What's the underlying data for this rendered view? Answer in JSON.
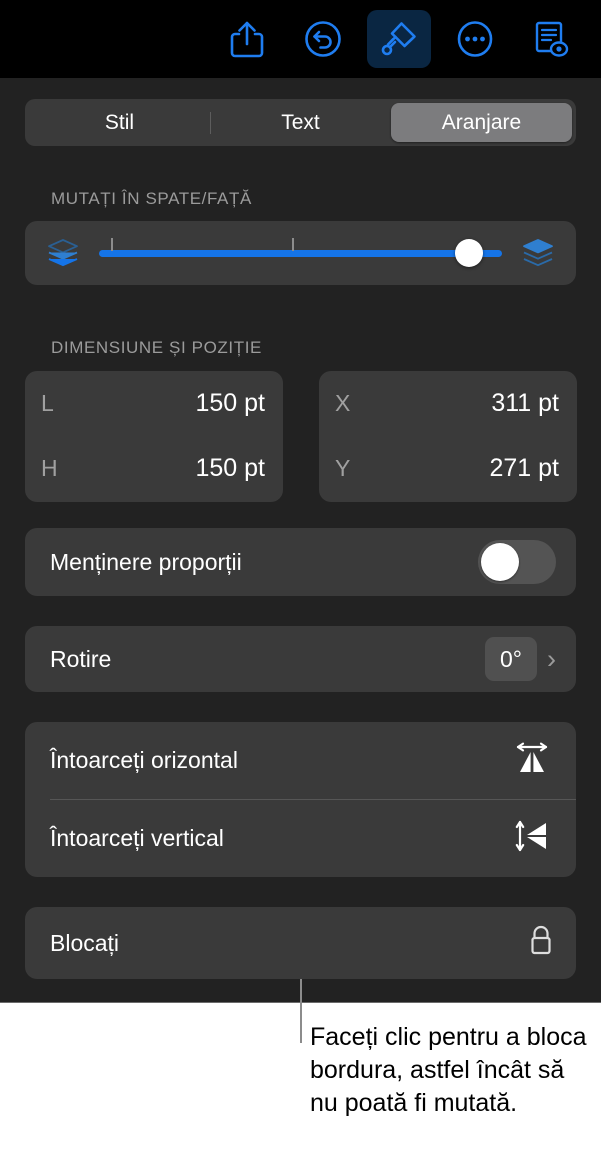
{
  "toolbar": {
    "buttons": [
      {
        "name": "share-icon",
        "label": "Partajați"
      },
      {
        "name": "undo-icon",
        "label": "Anulați"
      },
      {
        "name": "format-brush-icon",
        "label": "Format",
        "active": true
      },
      {
        "name": "more-options-icon",
        "label": "Mai multe"
      },
      {
        "name": "document-view-icon",
        "label": "Vizualizare document"
      }
    ]
  },
  "tabs": {
    "items": [
      {
        "label": "Stil",
        "selected": false
      },
      {
        "label": "Text",
        "selected": false
      },
      {
        "label": "Aranjare",
        "selected": true
      }
    ]
  },
  "arrange": {
    "back_front": {
      "title": "MUTAȚI ÎN SPATE/FAȚĂ",
      "slider": {
        "value_percent": 95,
        "tick_percents": [
          3,
          48
        ],
        "back_icon": "send-to-back-icon",
        "front_icon": "bring-to-front-icon",
        "accent_color": "#1574e8"
      }
    },
    "size_position": {
      "title": "DIMENSIUNE ȘI POZIȚIE",
      "size_fields": [
        {
          "label": "L",
          "value": "150 pt"
        },
        {
          "label": "H",
          "value": "150 pt"
        }
      ],
      "position_fields": [
        {
          "label": "X",
          "value": "311 pt"
        },
        {
          "label": "Y",
          "value": "271 pt"
        }
      ]
    },
    "constrain": {
      "label": "Menținere proporții",
      "toggle_on": false
    },
    "rotation": {
      "label": "Rotire",
      "value": "0°",
      "disclosure": "›"
    },
    "flip": {
      "horizontal_label": "Întoarceți orizontal",
      "horizontal_icon": "flip-horizontal-icon",
      "vertical_label": "Întoarceți vertical",
      "vertical_icon": "flip-vertical-icon"
    },
    "lock": {
      "label": "Blocați",
      "icon": "lock-icon"
    }
  },
  "callout": {
    "text": "Faceți clic pentru a bloca bordura, astfel încât să nu poată fi mutată."
  }
}
